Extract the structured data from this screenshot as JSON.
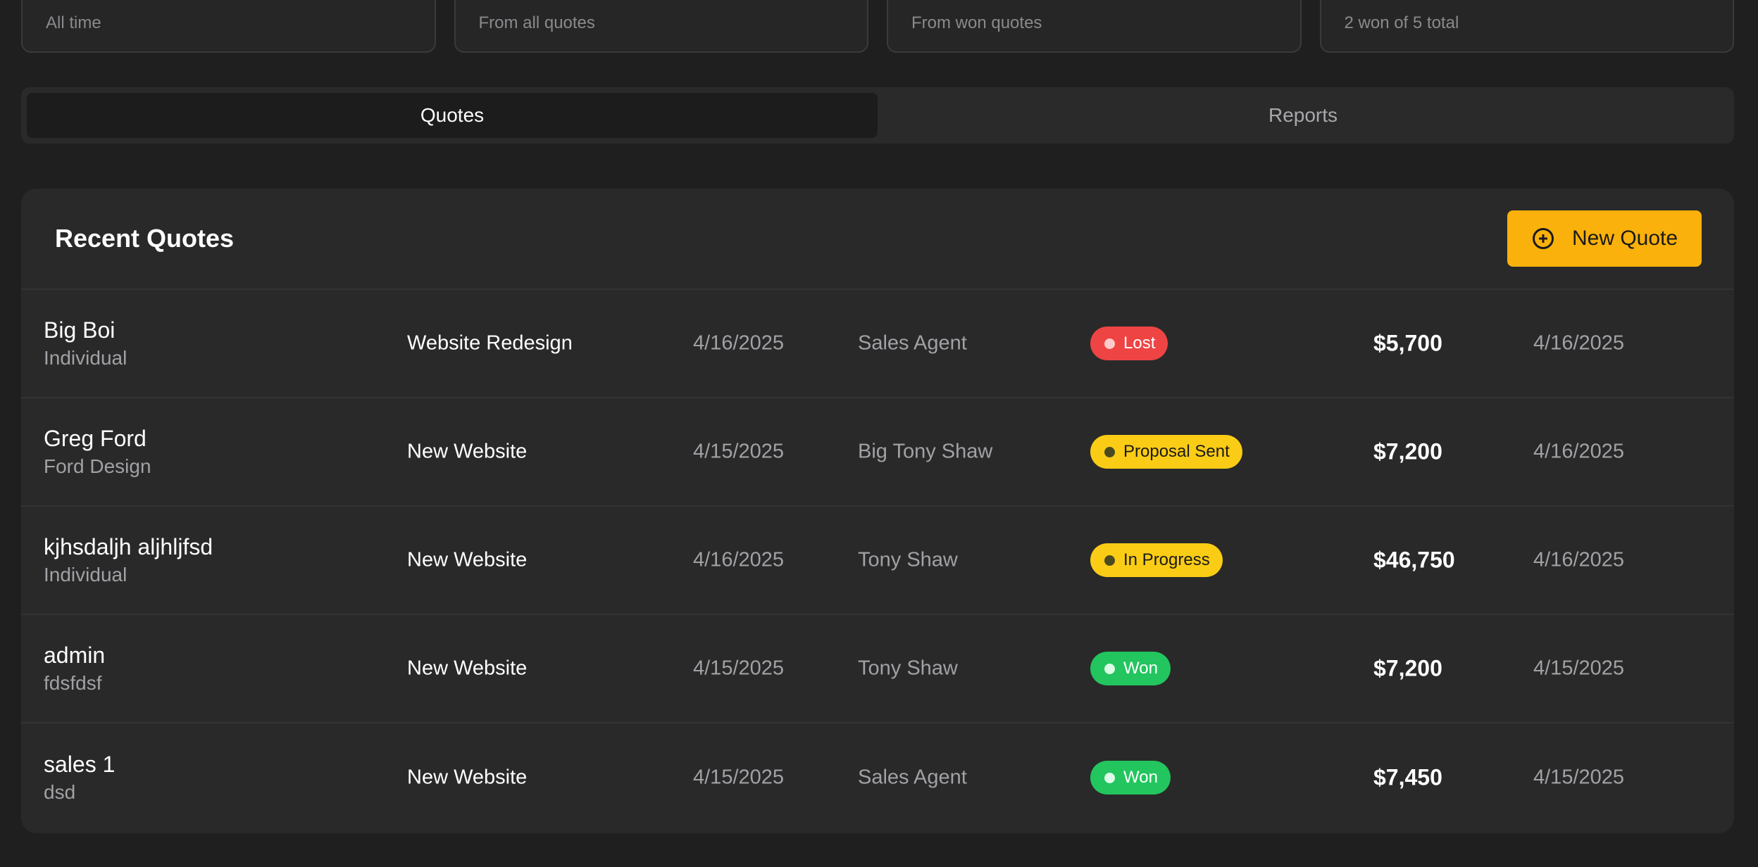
{
  "stats": [
    {
      "sub": "All time"
    },
    {
      "sub": "From all quotes"
    },
    {
      "sub": "From won quotes"
    },
    {
      "sub": "2 won of 5 total"
    }
  ],
  "tabs": [
    {
      "label": "Quotes",
      "active": true
    },
    {
      "label": "Reports",
      "active": false
    }
  ],
  "panel": {
    "title": "Recent Quotes",
    "new_quote_label": "New Quote"
  },
  "quotes": [
    {
      "name": "Big Boi",
      "company": "Individual",
      "project": "Website Redesign",
      "date": "4/16/2025",
      "agent": "Sales Agent",
      "status": "Lost",
      "status_kind": "lost",
      "amount": "$5,700",
      "updated": "4/16/2025"
    },
    {
      "name": "Greg Ford",
      "company": "Ford Design",
      "project": "New Website",
      "date": "4/15/2025",
      "agent": "Big Tony Shaw",
      "status": "Proposal Sent",
      "status_kind": "sent",
      "amount": "$7,200",
      "updated": "4/16/2025"
    },
    {
      "name": "kjhsdaljh aljhljfsd",
      "company": "Individual",
      "project": "New Website",
      "date": "4/16/2025",
      "agent": "Tony Shaw",
      "status": "In Progress",
      "status_kind": "sent",
      "amount": "$46,750",
      "updated": "4/16/2025"
    },
    {
      "name": "admin",
      "company": "fdsfdsf",
      "project": "New Website",
      "date": "4/15/2025",
      "agent": "Tony Shaw",
      "status": "Won",
      "status_kind": "won",
      "amount": "$7,200",
      "updated": "4/15/2025"
    },
    {
      "name": "sales 1",
      "company": "dsd",
      "project": "New Website",
      "date": "4/15/2025",
      "agent": "Sales Agent",
      "status": "Won",
      "status_kind": "won",
      "amount": "$7,450",
      "updated": "4/15/2025"
    }
  ],
  "colors": {
    "accent": "#fbb10b",
    "lost": "#ef4444",
    "pending": "#facc15",
    "won": "#22c55e"
  }
}
